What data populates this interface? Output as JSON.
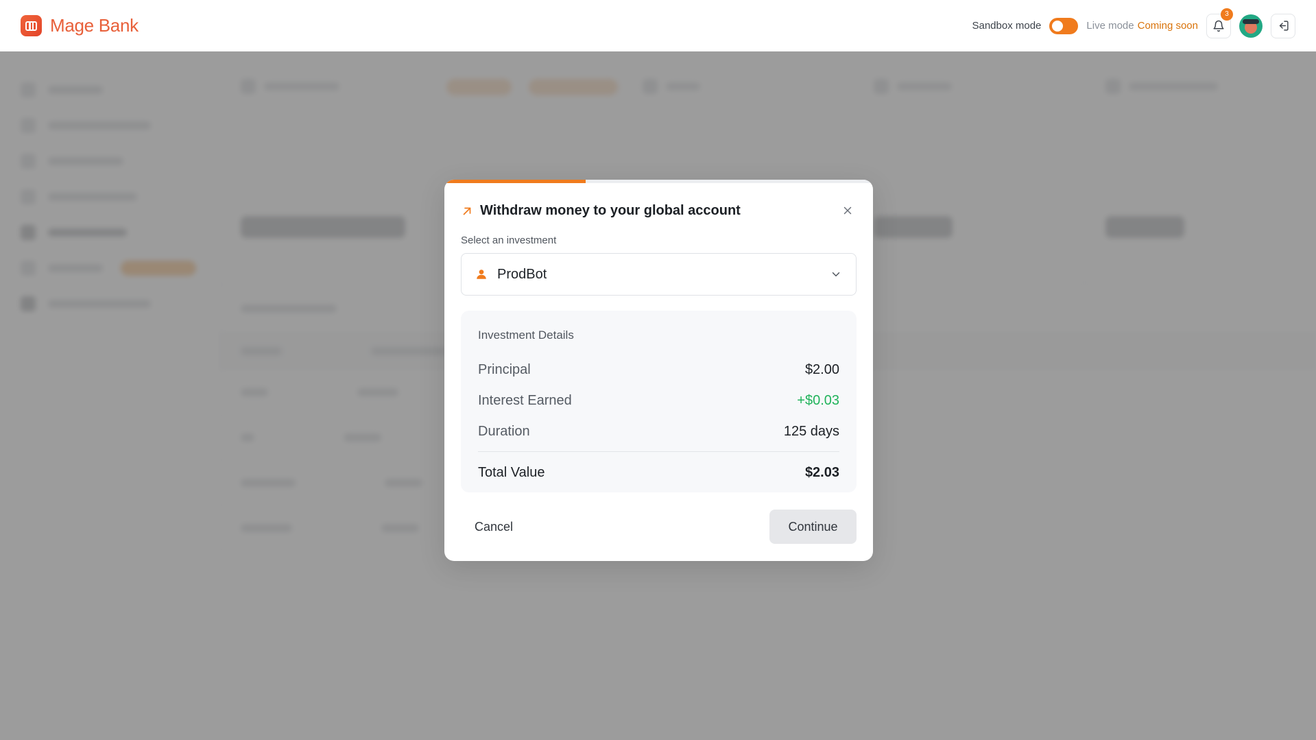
{
  "header": {
    "brand_name": "Mage Bank",
    "sandbox_label": "Sandbox mode",
    "live_label": "Live mode",
    "coming_soon": "Coming soon",
    "notification_count": "3"
  },
  "modal": {
    "title": "Withdraw money to your global account",
    "progress": 0.33,
    "select_label": "Select an investment",
    "selected_investment": "ProdBot",
    "details_title": "Investment Details",
    "principal_label": "Principal",
    "principal_value": "$2.00",
    "interest_label": "Interest Earned",
    "interest_value": "+$0.03",
    "duration_label": "Duration",
    "duration_value": "125 days",
    "total_label": "Total Value",
    "total_value": "$2.03",
    "cancel_label": "Cancel",
    "continue_label": "Continue"
  },
  "colors": {
    "accent": "#f07b1d",
    "positive": "#21b35b"
  }
}
